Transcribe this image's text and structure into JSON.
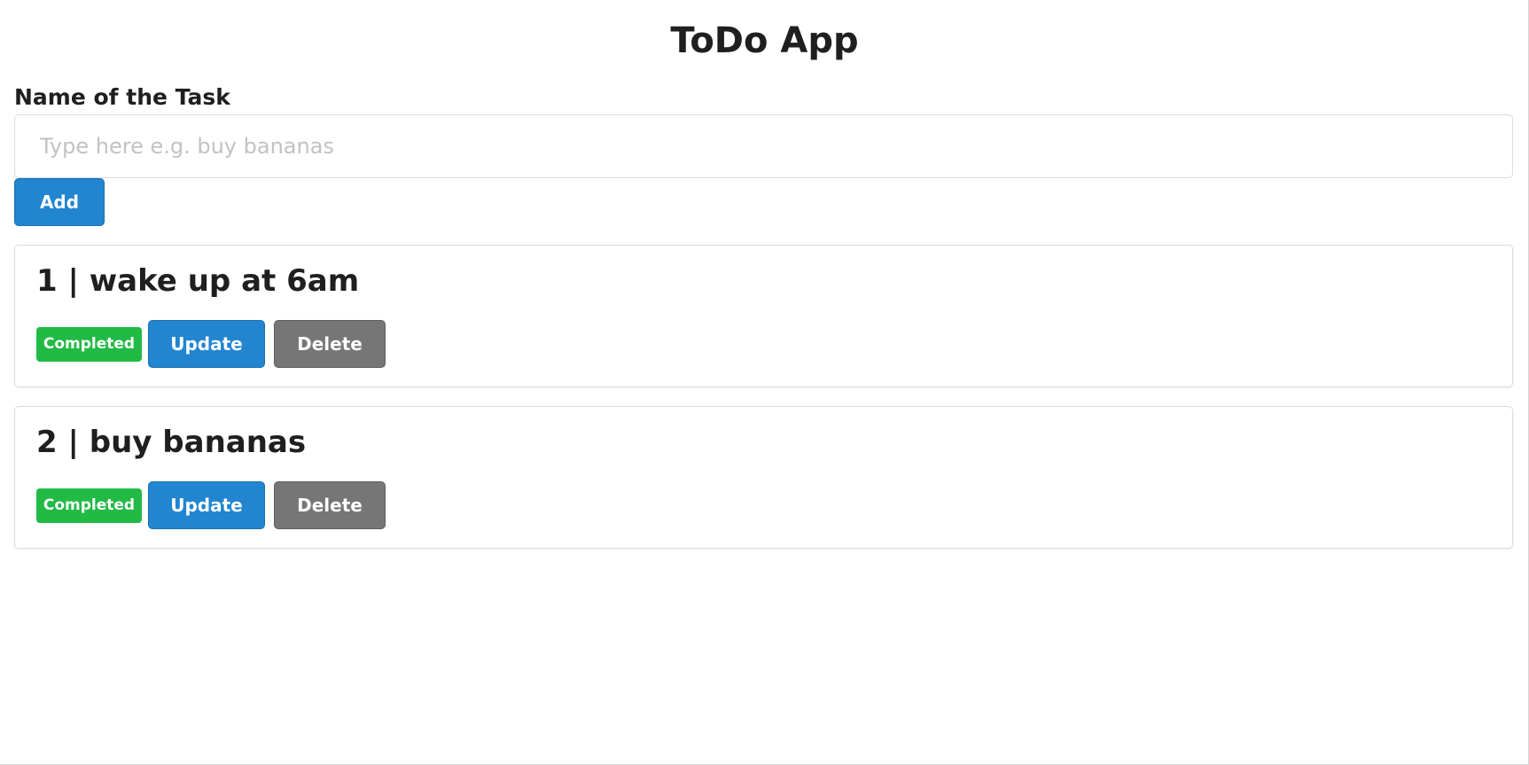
{
  "header": {
    "title": "ToDo App"
  },
  "form": {
    "label": "Name of the Task",
    "input_value": "",
    "input_placeholder": "Type here e.g. buy bananas",
    "add_label": "Add"
  },
  "tasks": [
    {
      "heading": "1 | wake up at 6am",
      "status": "Completed",
      "update_label": "Update",
      "delete_label": "Delete"
    },
    {
      "heading": "2 | buy bananas",
      "status": "Completed",
      "update_label": "Update",
      "delete_label": "Delete"
    }
  ],
  "colors": {
    "primary": "#2185d0",
    "success": "#21ba45",
    "secondary": "#767676"
  }
}
